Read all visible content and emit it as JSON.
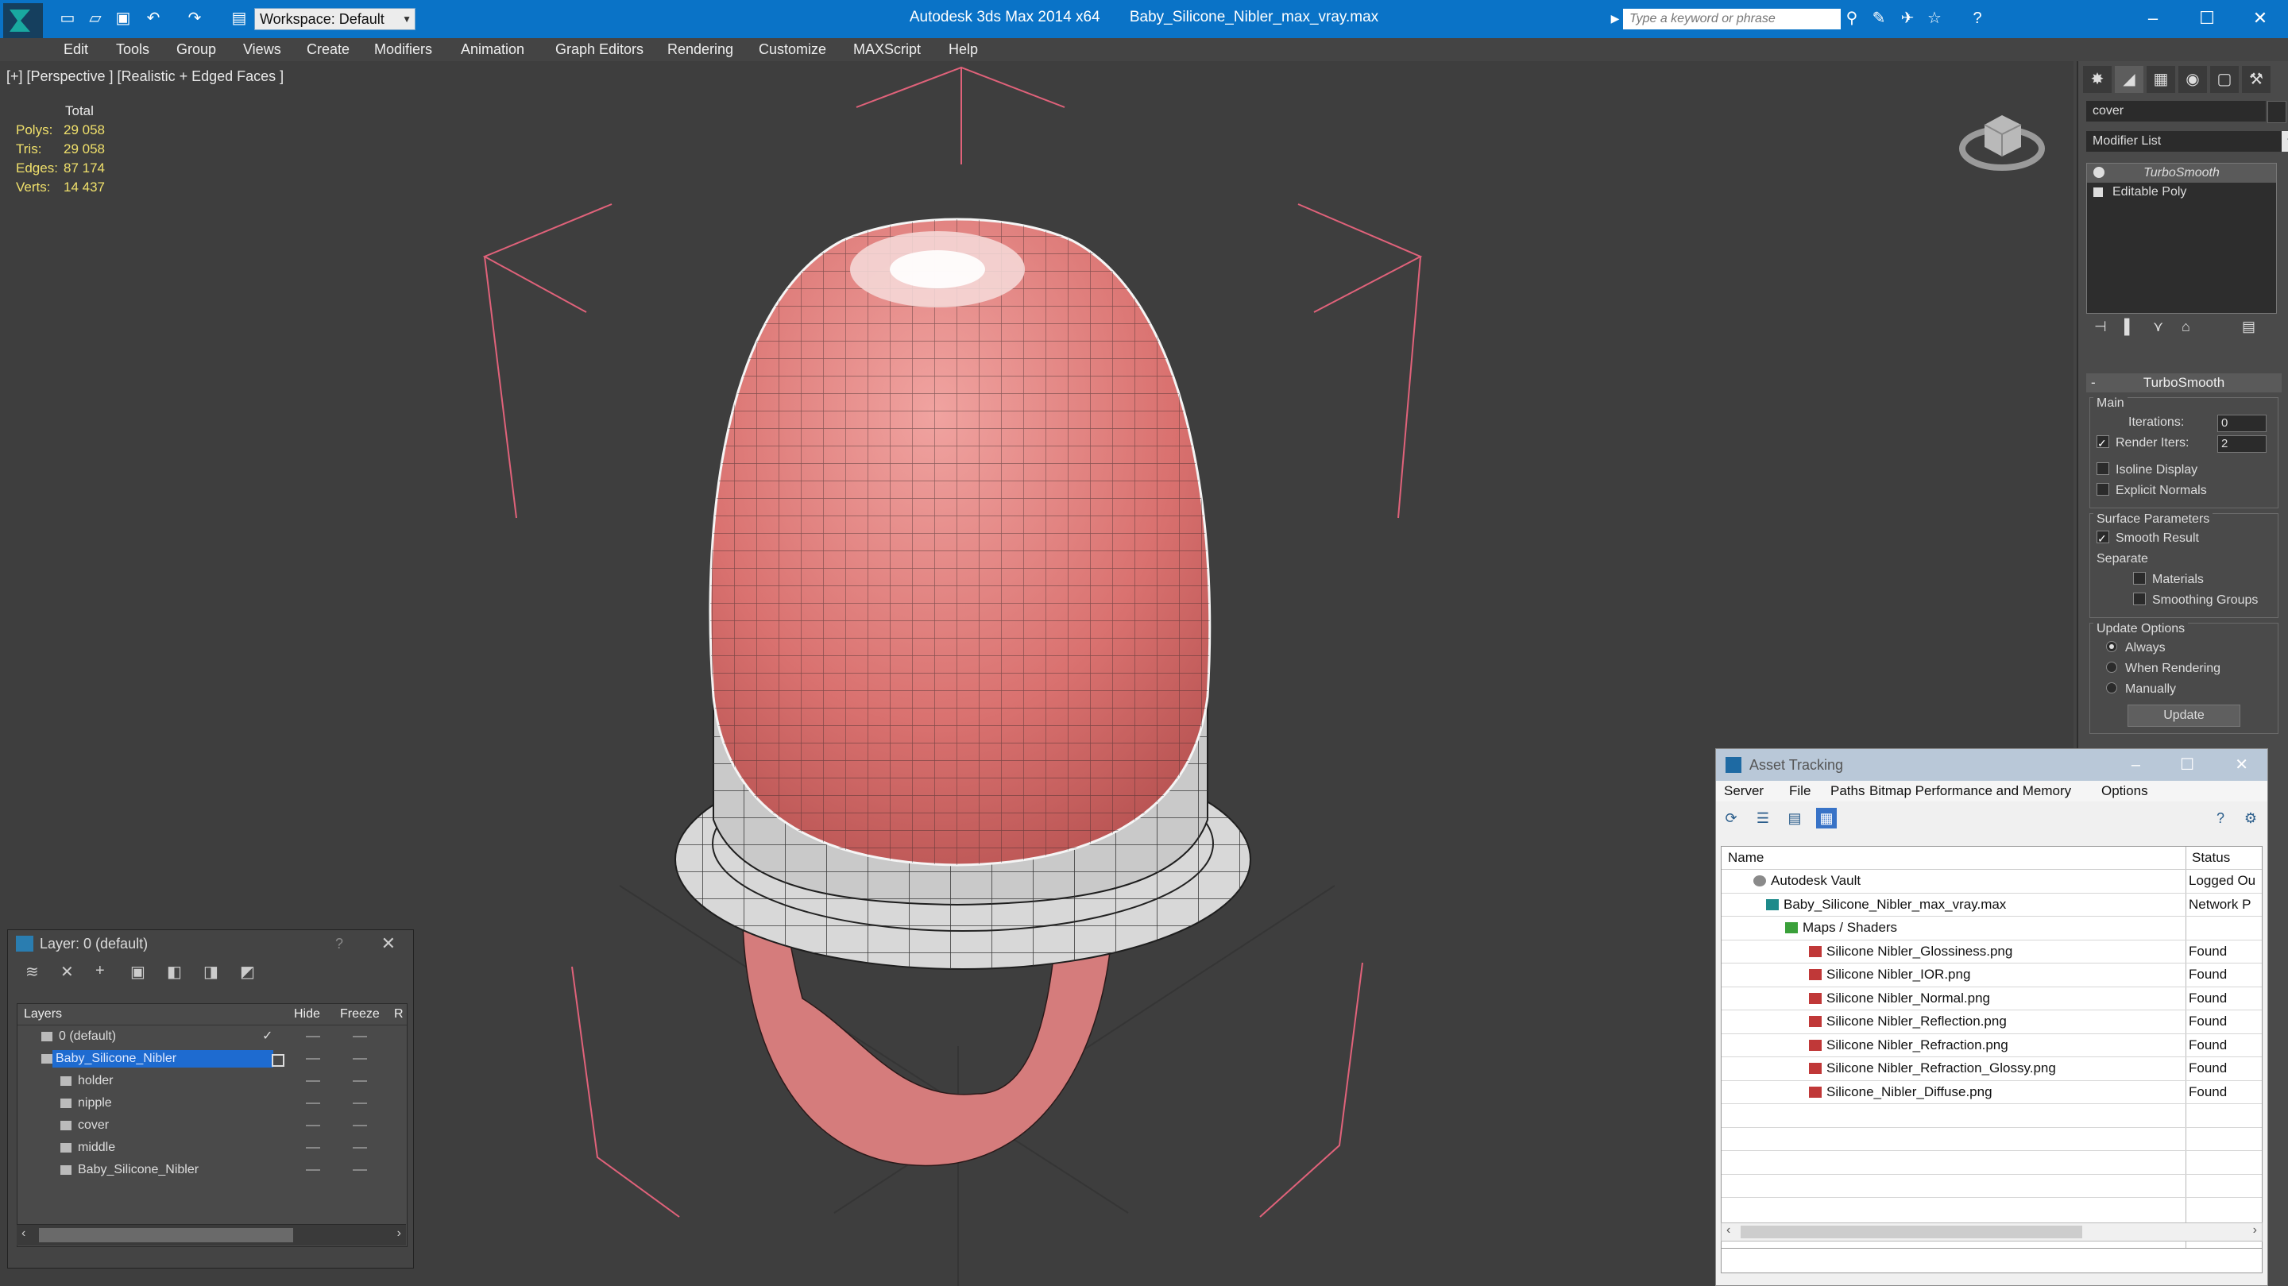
{
  "titlebar": {
    "app_title": "Autodesk 3ds Max  2014 x64",
    "file_title": "Baby_Silicone_Nibler_max_vray.max",
    "workspace": "Workspace: Default",
    "search_placeholder": "Type a keyword or phrase"
  },
  "menu": [
    "Edit",
    "Tools",
    "Group",
    "Views",
    "Create",
    "Modifiers",
    "Animation",
    "Graph Editors",
    "Rendering",
    "Customize",
    "MAXScript",
    "Help"
  ],
  "viewport": {
    "label": "[+] [Perspective ] [Realistic + Edged Faces ]",
    "stats": {
      "header": "Total",
      "polys_label": "Polys:",
      "polys": "29 058",
      "tris_label": "Tris:",
      "tris": "29 058",
      "edges_label": "Edges:",
      "edges": "87 174",
      "verts_label": "Verts:",
      "verts": "14 437"
    }
  },
  "command_panel": {
    "object_name": "cover",
    "modifier_list": "Modifier List",
    "stack": [
      "TurboSmooth",
      "Editable Poly"
    ],
    "turbosmooth": {
      "title": "TurboSmooth",
      "main_label": "Main",
      "iterations_label": "Iterations:",
      "iterations": "0",
      "render_iters_label": "Render Iters:",
      "render_iters": "2",
      "isoline_label": "Isoline Display",
      "explicit_normals_label": "Explicit Normals",
      "surface_params_label": "Surface Parameters",
      "smooth_result_label": "Smooth Result",
      "separate_label": "Separate",
      "materials_label": "Materials",
      "smoothing_groups_label": "Smoothing Groups",
      "update_options_label": "Update Options",
      "always_label": "Always",
      "when_rendering_label": "When Rendering",
      "manually_label": "Manually",
      "update_button": "Update"
    }
  },
  "layer_window": {
    "title": "Layer: 0 (default)",
    "help": "?",
    "columns": {
      "layers": "Layers",
      "hide": "Hide",
      "freeze": "Freeze",
      "render": "R"
    },
    "rows": [
      "0 (default)",
      "Baby_Silicone_Nibler",
      "holder",
      "nipple",
      "cover",
      "middle",
      "Baby_Silicone_Nibler"
    ]
  },
  "asset_tracking": {
    "title": "Asset Tracking",
    "menu": [
      "Server",
      "File",
      "Paths",
      "Bitmap Performance and Memory",
      "Options"
    ],
    "columns": {
      "name": "Name",
      "status": "Status"
    },
    "rows": [
      {
        "name": "Autodesk Vault",
        "status": "Logged Ou"
      },
      {
        "name": "Baby_Silicone_Nibler_max_vray.max",
        "status": "Network P"
      },
      {
        "name": "Maps / Shaders",
        "status": ""
      },
      {
        "name": "Silicone Nibler_Glossiness.png",
        "status": "Found"
      },
      {
        "name": "Silicone Nibler_IOR.png",
        "status": "Found"
      },
      {
        "name": "Silicone Nibler_Normal.png",
        "status": "Found"
      },
      {
        "name": "Silicone Nibler_Reflection.png",
        "status": "Found"
      },
      {
        "name": "Silicone Nibler_Refraction.png",
        "status": "Found"
      },
      {
        "name": "Silicone Nibler_Refraction_Glossy.png",
        "status": "Found"
      },
      {
        "name": "Silicone_Nibler_Diffuse.png",
        "status": "Found"
      }
    ]
  },
  "colors": {
    "titlebar": "#0a73c7",
    "mesh_red": "#d4706e",
    "selection_bracket": "#e0627a",
    "stats_yellow": "#f0e06b"
  }
}
